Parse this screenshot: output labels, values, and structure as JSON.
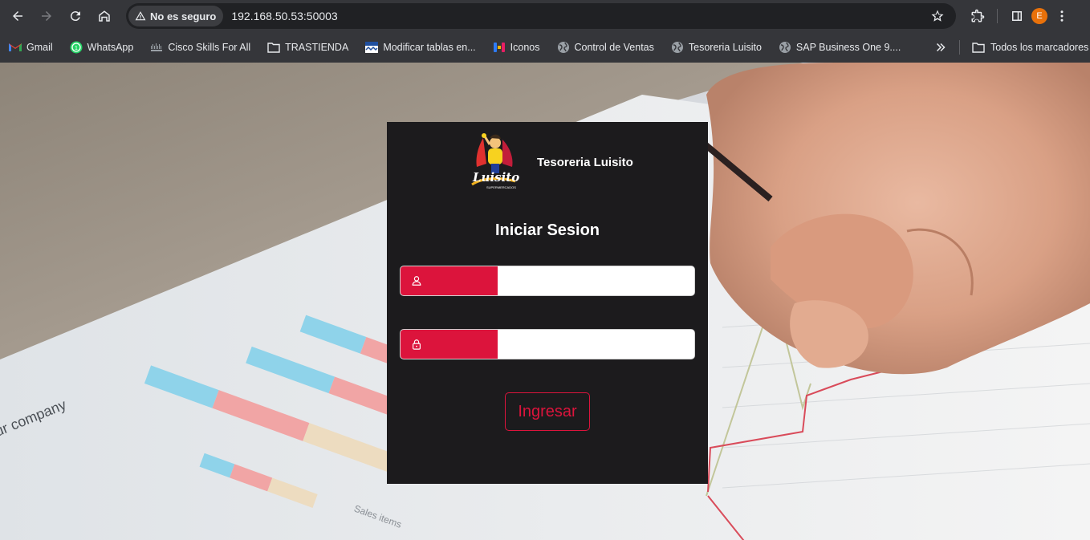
{
  "browser": {
    "security_label": "No es seguro",
    "url": "192.168.50.53:50003",
    "profile_initial": "E",
    "bookmarks": [
      {
        "label": "Gmail",
        "icon": "gmail-icon"
      },
      {
        "label": "WhatsApp",
        "icon": "whatsapp-icon"
      },
      {
        "label": "Cisco Skills For All",
        "icon": "cisco-icon"
      },
      {
        "label": "TRASTIENDA",
        "icon": "folder-icon"
      },
      {
        "label": "Modificar tablas en...",
        "icon": "site-icon"
      },
      {
        "label": "Iconos",
        "icon": "iconos-icon"
      },
      {
        "label": "Control de Ventas",
        "icon": "globe-icon"
      },
      {
        "label": "Tesoreria Luisito",
        "icon": "globe-icon"
      },
      {
        "label": "SAP Business One 9....",
        "icon": "globe-icon"
      }
    ],
    "all_bookmarks_label": "Todos los marcadores"
  },
  "login": {
    "brand_name": "Tesoreria Luisito",
    "title": "Iniciar Sesion",
    "username_value": "",
    "password_value": "",
    "submit_label": "Ingresar",
    "accent_color": "#dc143c"
  },
  "background": {
    "chart_text_1": "ur company",
    "chart_text_2": "Sales items"
  }
}
